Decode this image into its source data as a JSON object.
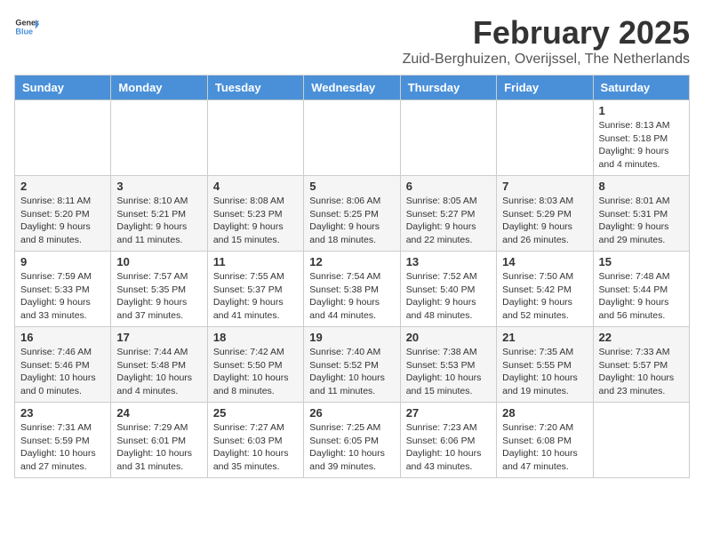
{
  "header": {
    "logo_general": "General",
    "logo_blue": "Blue",
    "month_year": "February 2025",
    "location": "Zuid-Berghuizen, Overijssel, The Netherlands"
  },
  "days_of_week": [
    "Sunday",
    "Monday",
    "Tuesday",
    "Wednesday",
    "Thursday",
    "Friday",
    "Saturday"
  ],
  "weeks": [
    {
      "row_class": "normal-row",
      "days": [
        {
          "num": "",
          "info": ""
        },
        {
          "num": "",
          "info": ""
        },
        {
          "num": "",
          "info": ""
        },
        {
          "num": "",
          "info": ""
        },
        {
          "num": "",
          "info": ""
        },
        {
          "num": "",
          "info": ""
        },
        {
          "num": "1",
          "info": "Sunrise: 8:13 AM\nSunset: 5:18 PM\nDaylight: 9 hours and 4 minutes."
        }
      ]
    },
    {
      "row_class": "alt-row",
      "days": [
        {
          "num": "2",
          "info": "Sunrise: 8:11 AM\nSunset: 5:20 PM\nDaylight: 9 hours and 8 minutes."
        },
        {
          "num": "3",
          "info": "Sunrise: 8:10 AM\nSunset: 5:21 PM\nDaylight: 9 hours and 11 minutes."
        },
        {
          "num": "4",
          "info": "Sunrise: 8:08 AM\nSunset: 5:23 PM\nDaylight: 9 hours and 15 minutes."
        },
        {
          "num": "5",
          "info": "Sunrise: 8:06 AM\nSunset: 5:25 PM\nDaylight: 9 hours and 18 minutes."
        },
        {
          "num": "6",
          "info": "Sunrise: 8:05 AM\nSunset: 5:27 PM\nDaylight: 9 hours and 22 minutes."
        },
        {
          "num": "7",
          "info": "Sunrise: 8:03 AM\nSunset: 5:29 PM\nDaylight: 9 hours and 26 minutes."
        },
        {
          "num": "8",
          "info": "Sunrise: 8:01 AM\nSunset: 5:31 PM\nDaylight: 9 hours and 29 minutes."
        }
      ]
    },
    {
      "row_class": "normal-row",
      "days": [
        {
          "num": "9",
          "info": "Sunrise: 7:59 AM\nSunset: 5:33 PM\nDaylight: 9 hours and 33 minutes."
        },
        {
          "num": "10",
          "info": "Sunrise: 7:57 AM\nSunset: 5:35 PM\nDaylight: 9 hours and 37 minutes."
        },
        {
          "num": "11",
          "info": "Sunrise: 7:55 AM\nSunset: 5:37 PM\nDaylight: 9 hours and 41 minutes."
        },
        {
          "num": "12",
          "info": "Sunrise: 7:54 AM\nSunset: 5:38 PM\nDaylight: 9 hours and 44 minutes."
        },
        {
          "num": "13",
          "info": "Sunrise: 7:52 AM\nSunset: 5:40 PM\nDaylight: 9 hours and 48 minutes."
        },
        {
          "num": "14",
          "info": "Sunrise: 7:50 AM\nSunset: 5:42 PM\nDaylight: 9 hours and 52 minutes."
        },
        {
          "num": "15",
          "info": "Sunrise: 7:48 AM\nSunset: 5:44 PM\nDaylight: 9 hours and 56 minutes."
        }
      ]
    },
    {
      "row_class": "alt-row",
      "days": [
        {
          "num": "16",
          "info": "Sunrise: 7:46 AM\nSunset: 5:46 PM\nDaylight: 10 hours and 0 minutes."
        },
        {
          "num": "17",
          "info": "Sunrise: 7:44 AM\nSunset: 5:48 PM\nDaylight: 10 hours and 4 minutes."
        },
        {
          "num": "18",
          "info": "Sunrise: 7:42 AM\nSunset: 5:50 PM\nDaylight: 10 hours and 8 minutes."
        },
        {
          "num": "19",
          "info": "Sunrise: 7:40 AM\nSunset: 5:52 PM\nDaylight: 10 hours and 11 minutes."
        },
        {
          "num": "20",
          "info": "Sunrise: 7:38 AM\nSunset: 5:53 PM\nDaylight: 10 hours and 15 minutes."
        },
        {
          "num": "21",
          "info": "Sunrise: 7:35 AM\nSunset: 5:55 PM\nDaylight: 10 hours and 19 minutes."
        },
        {
          "num": "22",
          "info": "Sunrise: 7:33 AM\nSunset: 5:57 PM\nDaylight: 10 hours and 23 minutes."
        }
      ]
    },
    {
      "row_class": "normal-row",
      "days": [
        {
          "num": "23",
          "info": "Sunrise: 7:31 AM\nSunset: 5:59 PM\nDaylight: 10 hours and 27 minutes."
        },
        {
          "num": "24",
          "info": "Sunrise: 7:29 AM\nSunset: 6:01 PM\nDaylight: 10 hours and 31 minutes."
        },
        {
          "num": "25",
          "info": "Sunrise: 7:27 AM\nSunset: 6:03 PM\nDaylight: 10 hours and 35 minutes."
        },
        {
          "num": "26",
          "info": "Sunrise: 7:25 AM\nSunset: 6:05 PM\nDaylight: 10 hours and 39 minutes."
        },
        {
          "num": "27",
          "info": "Sunrise: 7:23 AM\nSunset: 6:06 PM\nDaylight: 10 hours and 43 minutes."
        },
        {
          "num": "28",
          "info": "Sunrise: 7:20 AM\nSunset: 6:08 PM\nDaylight: 10 hours and 47 minutes."
        },
        {
          "num": "",
          "info": ""
        }
      ]
    }
  ]
}
